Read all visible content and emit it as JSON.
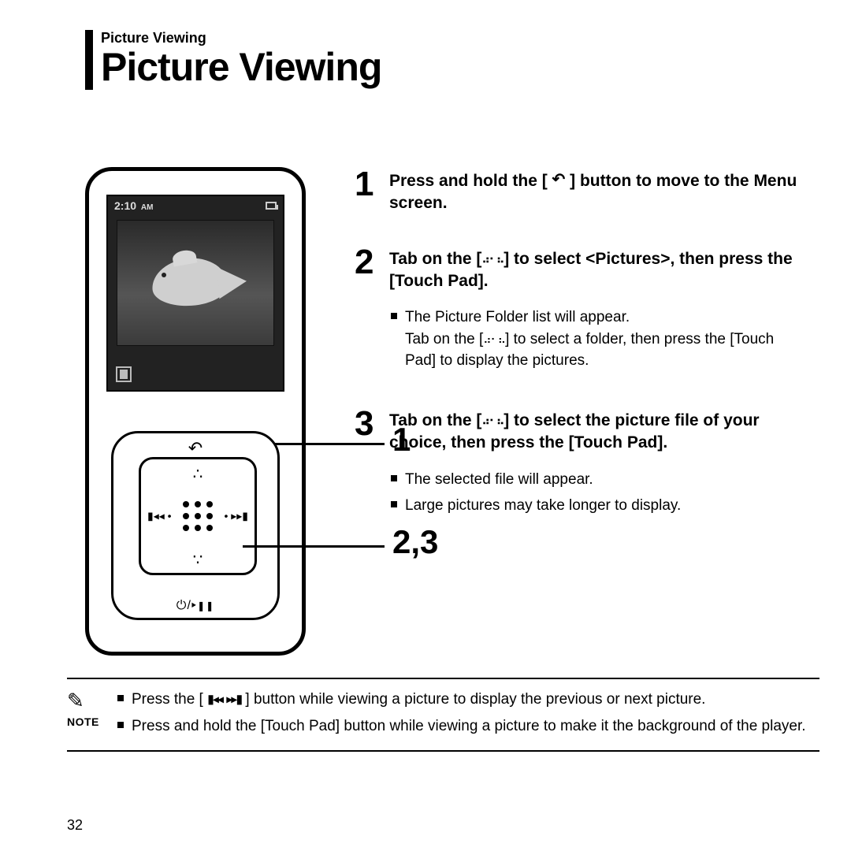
{
  "section_label": "Picture Viewing",
  "page_title": "Picture Viewing",
  "page_number": "32",
  "device": {
    "time": "2:10",
    "time_suffix": "AM"
  },
  "callouts": {
    "c1": "1",
    "c2": "2,3"
  },
  "icons": {
    "back": "↶",
    "dots_updown": "⠴⠂⠦",
    "prev": "I◂◂",
    "next": "▸▸I",
    "power": "⏻/▸▮▮",
    "note": "✎"
  },
  "steps": [
    {
      "num": "1",
      "bold_before": "Press and hold the [ ",
      "bold_after": " ] button to move to the Menu screen.",
      "icon": "back",
      "sub": []
    },
    {
      "num": "2",
      "bold_before": "Tab on the [",
      "bold_after": "] to select <Pictures>, then press the [Touch Pad].",
      "icon": "dots",
      "sub": [
        {
          "pre": "The Picture Folder list will appear.\nTab on the [",
          "post": "] to select a folder, then press the [Touch Pad] to display the pictures.",
          "icon": "dots"
        }
      ]
    },
    {
      "num": "3",
      "bold_before": "Tab on the [",
      "bold_after": "] to select the picture file of your choice, then press the [Touch Pad].",
      "icon": "dots",
      "sub": [
        {
          "pre": "The selected file will appear.",
          "post": "",
          "icon": ""
        },
        {
          "pre": "Large pictures may take longer to display.",
          "post": "",
          "icon": ""
        }
      ]
    }
  ],
  "note": {
    "label": "NOTE",
    "items": [
      {
        "pre": "Press the [ ",
        "mid": " ",
        "post": " ] button while viewing a picture to display the previous or next picture.",
        "icons": "prevnext"
      },
      {
        "pre": "Press and hold the [Touch Pad] button while viewing a picture to make it the background of the player.",
        "mid": "",
        "post": "",
        "icons": ""
      }
    ]
  }
}
